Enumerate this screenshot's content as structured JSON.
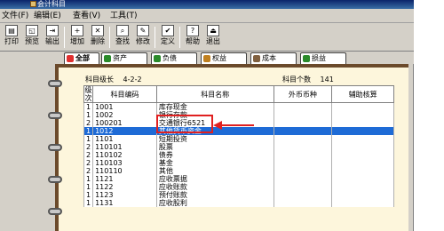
{
  "window": {
    "title": "会计科目"
  },
  "menu": [
    {
      "label": "文件(F)"
    },
    {
      "label": "编辑(E)"
    },
    {
      "label": "查看(V)"
    },
    {
      "label": "工具(T)"
    }
  ],
  "toolbar": [
    {
      "label": "打印",
      "icon": "print-icon"
    },
    {
      "label": "预览",
      "icon": "preview-icon"
    },
    {
      "label": "输出",
      "icon": "export-icon"
    },
    {
      "label": "增加",
      "icon": "add-icon"
    },
    {
      "label": "删除",
      "icon": "delete-icon"
    },
    {
      "label": "查找",
      "icon": "search-icon"
    },
    {
      "label": "修改",
      "icon": "edit-icon"
    },
    {
      "label": "定义",
      "icon": "define-icon"
    },
    {
      "label": "帮助",
      "icon": "help-icon"
    },
    {
      "label": "退出",
      "icon": "exit-icon"
    }
  ],
  "tabs": [
    {
      "label": "全部",
      "color": "#e03030"
    },
    {
      "label": "资产",
      "color": "#2a8a2a"
    },
    {
      "label": "负债",
      "color": "#2a8a2a"
    },
    {
      "label": "权益",
      "color": "#c08020"
    },
    {
      "label": "成本",
      "color": "#806040"
    },
    {
      "label": "损益",
      "color": "#2a8a2a"
    }
  ],
  "info": {
    "code_length_label": "科目级长",
    "code_length_value": "4-2-2",
    "count_label": "科目个数",
    "count_value": "141"
  },
  "table": {
    "headers": [
      "级次",
      "科目编码",
      "科目名称",
      "外币币种",
      "辅助核算"
    ],
    "rows": [
      {
        "level": "1",
        "code": "1001",
        "name": "库存现金",
        "currency": "",
        "aux": ""
      },
      {
        "level": "1",
        "code": "1002",
        "name": "银行存款",
        "currency": "",
        "aux": ""
      },
      {
        "level": "2",
        "code": "100201",
        "name": "  交通银行6521",
        "currency": "",
        "aux": ""
      },
      {
        "level": "1",
        "code": "1012",
        "name": "其他货币资金",
        "currency": "",
        "aux": "",
        "selected": true
      },
      {
        "level": "1",
        "code": "1101",
        "name": "短期投资",
        "currency": "",
        "aux": ""
      },
      {
        "level": "2",
        "code": "110101",
        "name": "  股票",
        "currency": "",
        "aux": ""
      },
      {
        "level": "2",
        "code": "110102",
        "name": "  债券",
        "currency": "",
        "aux": ""
      },
      {
        "level": "2",
        "code": "110103",
        "name": "  基金",
        "currency": "",
        "aux": ""
      },
      {
        "level": "2",
        "code": "110110",
        "name": "  其他",
        "currency": "",
        "aux": ""
      },
      {
        "level": "1",
        "code": "1121",
        "name": "应收票据",
        "currency": "",
        "aux": ""
      },
      {
        "level": "1",
        "code": "1122",
        "name": "应收账款",
        "currency": "",
        "aux": ""
      },
      {
        "level": "1",
        "code": "1123",
        "name": "预付账款",
        "currency": "",
        "aux": ""
      },
      {
        "level": "1",
        "code": "1131",
        "name": "应收股利",
        "currency": "",
        "aux": ""
      }
    ]
  },
  "colors": {
    "selection": "#1e6bd6",
    "annotation": "#e02020",
    "binder": "#6b4a2b"
  }
}
